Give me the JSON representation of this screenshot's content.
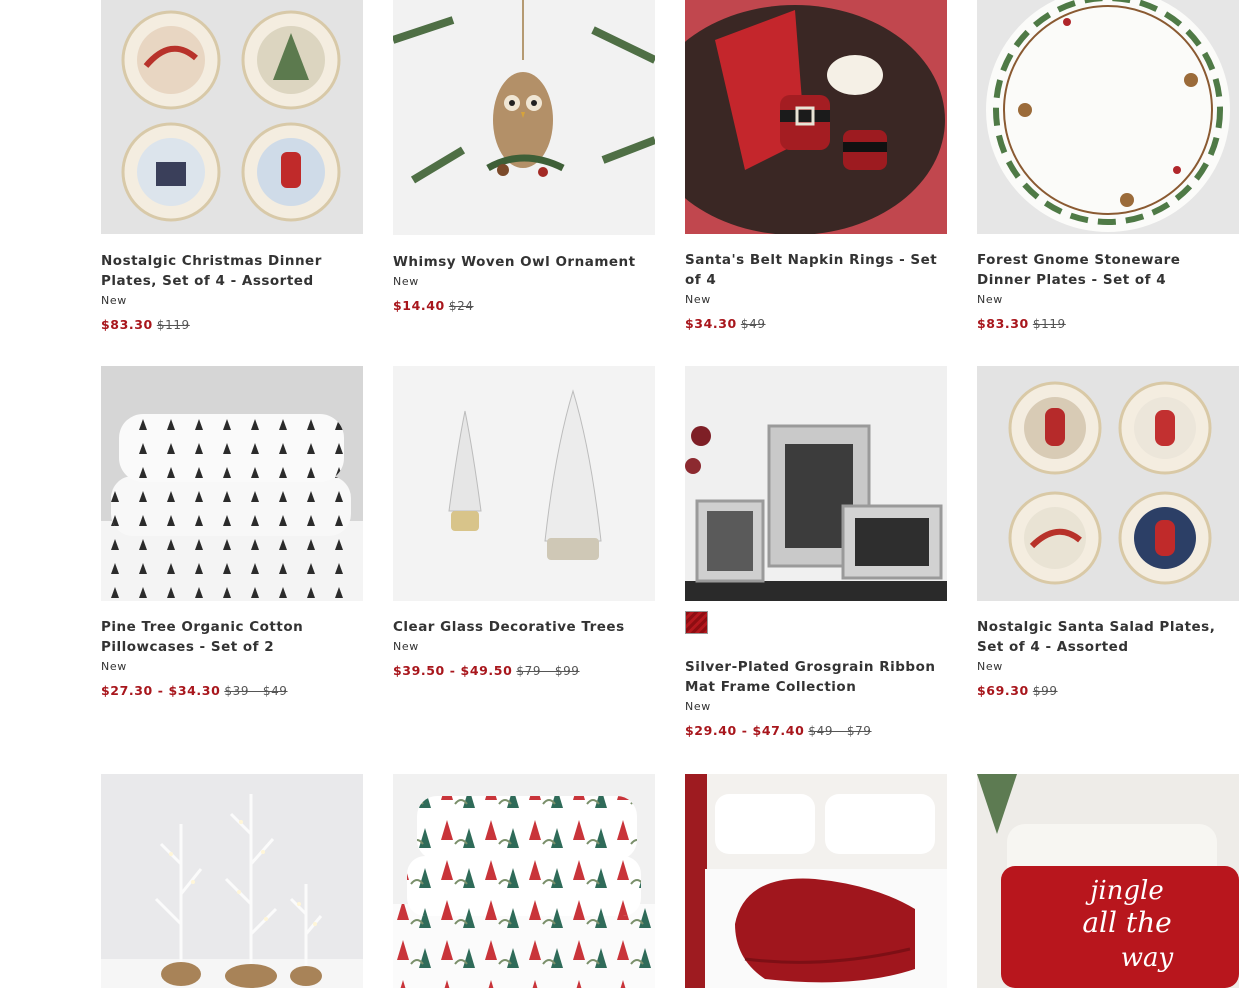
{
  "products": [
    {
      "name": "Nostalgic Christmas Dinner Plates, Set of 4 - Assorted",
      "badge": "New",
      "sale": "$83.30",
      "orig": "$119"
    },
    {
      "name": "Whimsy Woven Owl Ornament",
      "badge": "New",
      "sale": "$14.40",
      "orig": "$24"
    },
    {
      "name": "Santa's Belt Napkin Rings - Set of 4",
      "badge": "New",
      "sale": "$34.30",
      "orig": "$49"
    },
    {
      "name": "Forest Gnome Stoneware Dinner Plates - Set of 4",
      "badge": "New",
      "sale": "$83.30",
      "orig": "$119"
    },
    {
      "name": "Pine Tree Organic Cotton Pillowcases - Set of 2",
      "badge": "New",
      "sale": "$27.30 - $34.30",
      "orig": "$39 - $49"
    },
    {
      "name": "Clear Glass Decorative Trees",
      "badge": "New",
      "sale": "$39.50 - $49.50",
      "orig": "$79 - $99"
    },
    {
      "name": "Silver-Plated Grosgrain Ribbon Mat Frame Collection",
      "badge": "New",
      "sale": "$29.40 - $47.40",
      "orig": "$49 - $79"
    },
    {
      "name": "Nostalgic Santa Salad Plates, Set of 4 - Assorted",
      "badge": "New",
      "sale": "$69.30",
      "orig": "$99"
    }
  ],
  "pillow_text": [
    "jingle",
    "all the",
    "way"
  ],
  "colors": {
    "sale_red": "#a8161c",
    "swatch_red": "#b4171d"
  }
}
